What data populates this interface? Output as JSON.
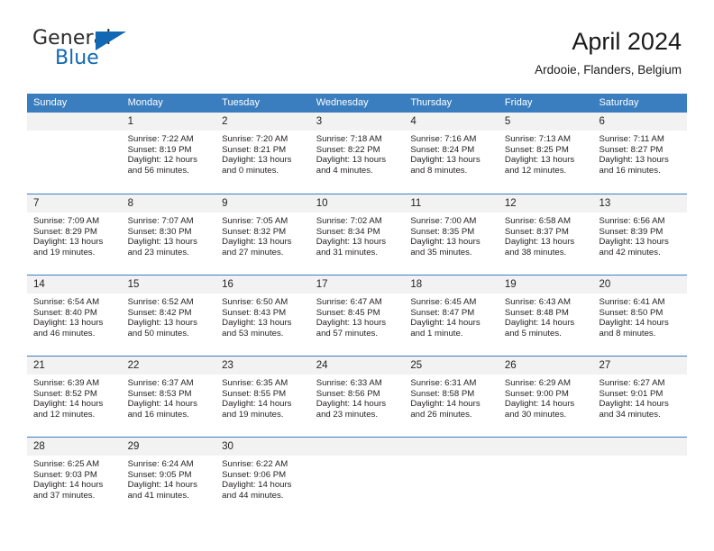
{
  "brand": {
    "word_one": "General",
    "word_two": "Blue",
    "accent_color": "#1268b3"
  },
  "header": {
    "title": "April 2024",
    "subtitle": "Ardooie, Flanders, Belgium"
  },
  "theme": {
    "header_blue": "#3a7ebf",
    "day_number_band": "#f2f2f2",
    "text": "#231f20"
  },
  "weekdays": [
    "Sunday",
    "Monday",
    "Tuesday",
    "Wednesday",
    "Thursday",
    "Friday",
    "Saturday"
  ],
  "labels": {
    "sunrise": "Sunrise:",
    "sunset": "Sunset:",
    "daylight": "Daylight:"
  },
  "weeks": [
    [
      {
        "day": "",
        "sunrise": "",
        "sunset": "",
        "daylight_line1": "",
        "daylight_line2": ""
      },
      {
        "day": "1",
        "sunrise": "Sunrise: 7:22 AM",
        "sunset": "Sunset: 8:19 PM",
        "daylight_line1": "Daylight: 12 hours",
        "daylight_line2": "and 56 minutes."
      },
      {
        "day": "2",
        "sunrise": "Sunrise: 7:20 AM",
        "sunset": "Sunset: 8:21 PM",
        "daylight_line1": "Daylight: 13 hours",
        "daylight_line2": "and 0 minutes."
      },
      {
        "day": "3",
        "sunrise": "Sunrise: 7:18 AM",
        "sunset": "Sunset: 8:22 PM",
        "daylight_line1": "Daylight: 13 hours",
        "daylight_line2": "and 4 minutes."
      },
      {
        "day": "4",
        "sunrise": "Sunrise: 7:16 AM",
        "sunset": "Sunset: 8:24 PM",
        "daylight_line1": "Daylight: 13 hours",
        "daylight_line2": "and 8 minutes."
      },
      {
        "day": "5",
        "sunrise": "Sunrise: 7:13 AM",
        "sunset": "Sunset: 8:25 PM",
        "daylight_line1": "Daylight: 13 hours",
        "daylight_line2": "and 12 minutes."
      },
      {
        "day": "6",
        "sunrise": "Sunrise: 7:11 AM",
        "sunset": "Sunset: 8:27 PM",
        "daylight_line1": "Daylight: 13 hours",
        "daylight_line2": "and 16 minutes."
      }
    ],
    [
      {
        "day": "7",
        "sunrise": "Sunrise: 7:09 AM",
        "sunset": "Sunset: 8:29 PM",
        "daylight_line1": "Daylight: 13 hours",
        "daylight_line2": "and 19 minutes."
      },
      {
        "day": "8",
        "sunrise": "Sunrise: 7:07 AM",
        "sunset": "Sunset: 8:30 PM",
        "daylight_line1": "Daylight: 13 hours",
        "daylight_line2": "and 23 minutes."
      },
      {
        "day": "9",
        "sunrise": "Sunrise: 7:05 AM",
        "sunset": "Sunset: 8:32 PM",
        "daylight_line1": "Daylight: 13 hours",
        "daylight_line2": "and 27 minutes."
      },
      {
        "day": "10",
        "sunrise": "Sunrise: 7:02 AM",
        "sunset": "Sunset: 8:34 PM",
        "daylight_line1": "Daylight: 13 hours",
        "daylight_line2": "and 31 minutes."
      },
      {
        "day": "11",
        "sunrise": "Sunrise: 7:00 AM",
        "sunset": "Sunset: 8:35 PM",
        "daylight_line1": "Daylight: 13 hours",
        "daylight_line2": "and 35 minutes."
      },
      {
        "day": "12",
        "sunrise": "Sunrise: 6:58 AM",
        "sunset": "Sunset: 8:37 PM",
        "daylight_line1": "Daylight: 13 hours",
        "daylight_line2": "and 38 minutes."
      },
      {
        "day": "13",
        "sunrise": "Sunrise: 6:56 AM",
        "sunset": "Sunset: 8:39 PM",
        "daylight_line1": "Daylight: 13 hours",
        "daylight_line2": "and 42 minutes."
      }
    ],
    [
      {
        "day": "14",
        "sunrise": "Sunrise: 6:54 AM",
        "sunset": "Sunset: 8:40 PM",
        "daylight_line1": "Daylight: 13 hours",
        "daylight_line2": "and 46 minutes."
      },
      {
        "day": "15",
        "sunrise": "Sunrise: 6:52 AM",
        "sunset": "Sunset: 8:42 PM",
        "daylight_line1": "Daylight: 13 hours",
        "daylight_line2": "and 50 minutes."
      },
      {
        "day": "16",
        "sunrise": "Sunrise: 6:50 AM",
        "sunset": "Sunset: 8:43 PM",
        "daylight_line1": "Daylight: 13 hours",
        "daylight_line2": "and 53 minutes."
      },
      {
        "day": "17",
        "sunrise": "Sunrise: 6:47 AM",
        "sunset": "Sunset: 8:45 PM",
        "daylight_line1": "Daylight: 13 hours",
        "daylight_line2": "and 57 minutes."
      },
      {
        "day": "18",
        "sunrise": "Sunrise: 6:45 AM",
        "sunset": "Sunset: 8:47 PM",
        "daylight_line1": "Daylight: 14 hours",
        "daylight_line2": "and 1 minute."
      },
      {
        "day": "19",
        "sunrise": "Sunrise: 6:43 AM",
        "sunset": "Sunset: 8:48 PM",
        "daylight_line1": "Daylight: 14 hours",
        "daylight_line2": "and 5 minutes."
      },
      {
        "day": "20",
        "sunrise": "Sunrise: 6:41 AM",
        "sunset": "Sunset: 8:50 PM",
        "daylight_line1": "Daylight: 14 hours",
        "daylight_line2": "and 8 minutes."
      }
    ],
    [
      {
        "day": "21",
        "sunrise": "Sunrise: 6:39 AM",
        "sunset": "Sunset: 8:52 PM",
        "daylight_line1": "Daylight: 14 hours",
        "daylight_line2": "and 12 minutes."
      },
      {
        "day": "22",
        "sunrise": "Sunrise: 6:37 AM",
        "sunset": "Sunset: 8:53 PM",
        "daylight_line1": "Daylight: 14 hours",
        "daylight_line2": "and 16 minutes."
      },
      {
        "day": "23",
        "sunrise": "Sunrise: 6:35 AM",
        "sunset": "Sunset: 8:55 PM",
        "daylight_line1": "Daylight: 14 hours",
        "daylight_line2": "and 19 minutes."
      },
      {
        "day": "24",
        "sunrise": "Sunrise: 6:33 AM",
        "sunset": "Sunset: 8:56 PM",
        "daylight_line1": "Daylight: 14 hours",
        "daylight_line2": "and 23 minutes."
      },
      {
        "day": "25",
        "sunrise": "Sunrise: 6:31 AM",
        "sunset": "Sunset: 8:58 PM",
        "daylight_line1": "Daylight: 14 hours",
        "daylight_line2": "and 26 minutes."
      },
      {
        "day": "26",
        "sunrise": "Sunrise: 6:29 AM",
        "sunset": "Sunset: 9:00 PM",
        "daylight_line1": "Daylight: 14 hours",
        "daylight_line2": "and 30 minutes."
      },
      {
        "day": "27",
        "sunrise": "Sunrise: 6:27 AM",
        "sunset": "Sunset: 9:01 PM",
        "daylight_line1": "Daylight: 14 hours",
        "daylight_line2": "and 34 minutes."
      }
    ],
    [
      {
        "day": "28",
        "sunrise": "Sunrise: 6:25 AM",
        "sunset": "Sunset: 9:03 PM",
        "daylight_line1": "Daylight: 14 hours",
        "daylight_line2": "and 37 minutes."
      },
      {
        "day": "29",
        "sunrise": "Sunrise: 6:24 AM",
        "sunset": "Sunset: 9:05 PM",
        "daylight_line1": "Daylight: 14 hours",
        "daylight_line2": "and 41 minutes."
      },
      {
        "day": "30",
        "sunrise": "Sunrise: 6:22 AM",
        "sunset": "Sunset: 9:06 PM",
        "daylight_line1": "Daylight: 14 hours",
        "daylight_line2": "and 44 minutes."
      },
      {
        "day": "",
        "sunrise": "",
        "sunset": "",
        "daylight_line1": "",
        "daylight_line2": ""
      },
      {
        "day": "",
        "sunrise": "",
        "sunset": "",
        "daylight_line1": "",
        "daylight_line2": ""
      },
      {
        "day": "",
        "sunrise": "",
        "sunset": "",
        "daylight_line1": "",
        "daylight_line2": ""
      },
      {
        "day": "",
        "sunrise": "",
        "sunset": "",
        "daylight_line1": "",
        "daylight_line2": ""
      }
    ]
  ]
}
